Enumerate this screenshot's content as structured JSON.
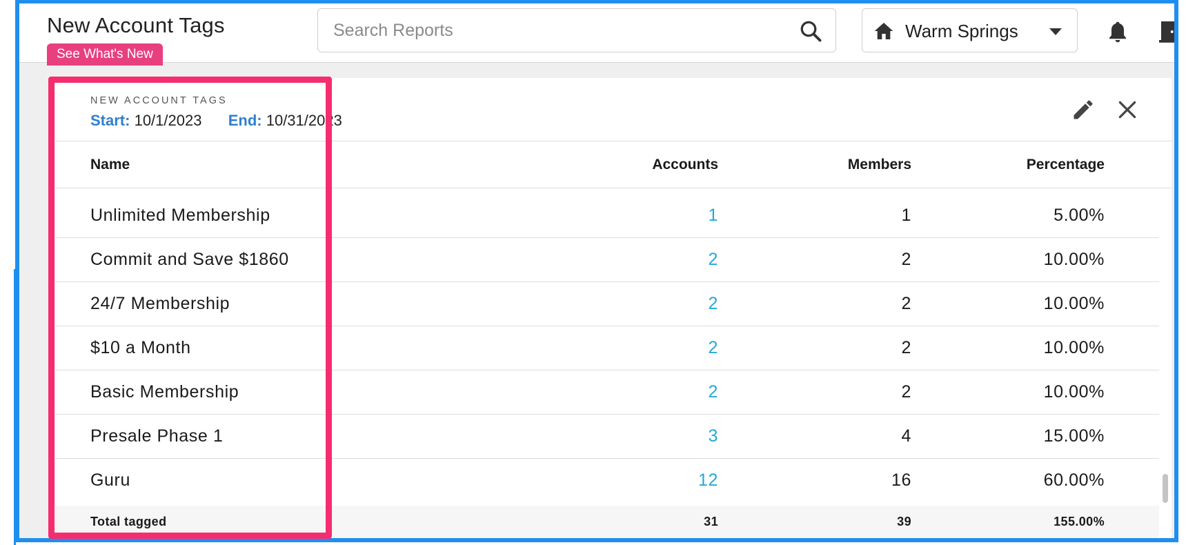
{
  "header": {
    "app_title": "New Account Tags",
    "whats_new_label": "See What's New",
    "search_placeholder": "Search Reports",
    "location": "Warm Springs",
    "icons": [
      "search-icon",
      "home-icon",
      "chevron-down-icon",
      "bell-icon",
      "door-icon"
    ]
  },
  "report": {
    "title": "NEW ACCOUNT TAGS",
    "start_label": "Start:",
    "start_date": "10/1/2023",
    "end_label": "End:",
    "end_date": "10/31/2023",
    "icons": [
      "edit-icon",
      "close-icon"
    ]
  },
  "table": {
    "columns": [
      "Name",
      "Accounts",
      "Members",
      "Percentage"
    ],
    "rows": [
      {
        "name": "Unlimited Membership",
        "accounts": "1",
        "members": "1",
        "percentage": "5.00%"
      },
      {
        "name": "Commit and Save $1860",
        "accounts": "2",
        "members": "2",
        "percentage": "10.00%"
      },
      {
        "name": "24/7 Membership",
        "accounts": "2",
        "members": "2",
        "percentage": "10.00%"
      },
      {
        "name": "$10 a Month",
        "accounts": "2",
        "members": "2",
        "percentage": "10.00%"
      },
      {
        "name": "Basic Membership",
        "accounts": "2",
        "members": "2",
        "percentage": "10.00%"
      },
      {
        "name": "Presale Phase 1",
        "accounts": "3",
        "members": "4",
        "percentage": "15.00%"
      },
      {
        "name": "Guru",
        "accounts": "12",
        "members": "16",
        "percentage": "60.00%"
      }
    ],
    "total": {
      "label": "Total tagged",
      "accounts": "31",
      "members": "39",
      "percentage": "155.00%"
    }
  },
  "colors": {
    "accent_pink": "#f52d6e",
    "frame_blue": "#1f8ef0",
    "link_blue": "#25a8d8",
    "date_label_blue": "#2f7fd0"
  }
}
